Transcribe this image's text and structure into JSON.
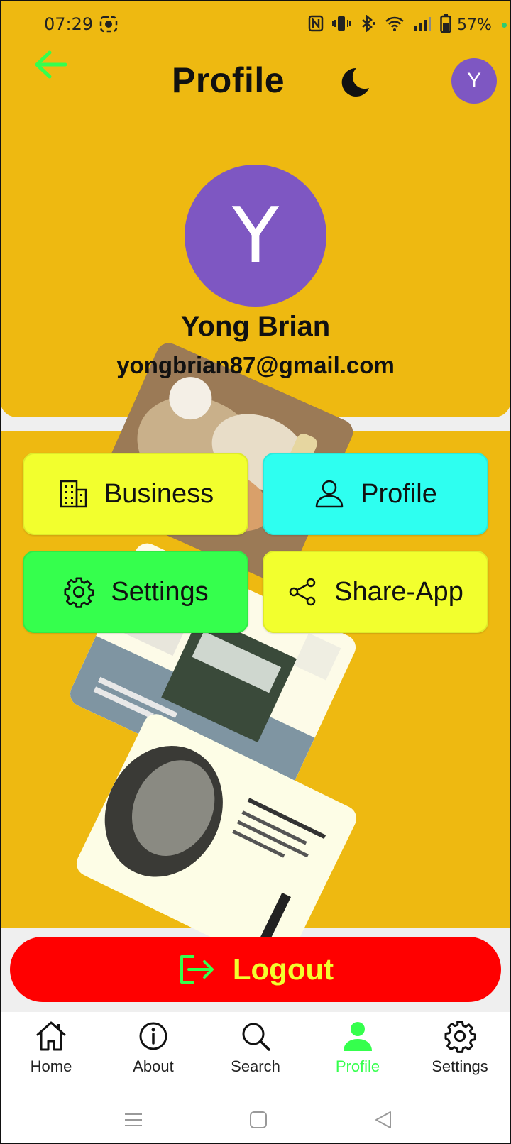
{
  "status_bar": {
    "time": "07:29",
    "battery": "57%"
  },
  "header": {
    "title": "Profile",
    "avatar_initial": "Y"
  },
  "profile": {
    "avatar_initial": "Y",
    "name": "Yong Brian",
    "email": "yongbrian87@gmail.com"
  },
  "tiles": {
    "business": "Business",
    "profile": "Profile",
    "settings": "Settings",
    "share": "Share-App"
  },
  "logout": {
    "label": "Logout"
  },
  "bottom_nav": {
    "items": [
      {
        "label": "Home",
        "icon": "home-icon"
      },
      {
        "label": "About",
        "icon": "info-icon"
      },
      {
        "label": "Search",
        "icon": "search-icon"
      },
      {
        "label": "Profile",
        "icon": "person-icon",
        "active": true
      },
      {
        "label": "Settings",
        "icon": "gear-icon"
      }
    ]
  },
  "colors": {
    "background_yellow": "#EEB911",
    "avatar_purple": "#7E57C2",
    "accent_green": "#35FF4D",
    "tile_yellow": "#F2FF2E",
    "tile_cyan": "#2EFFF0",
    "logout_red": "#FF0000"
  }
}
